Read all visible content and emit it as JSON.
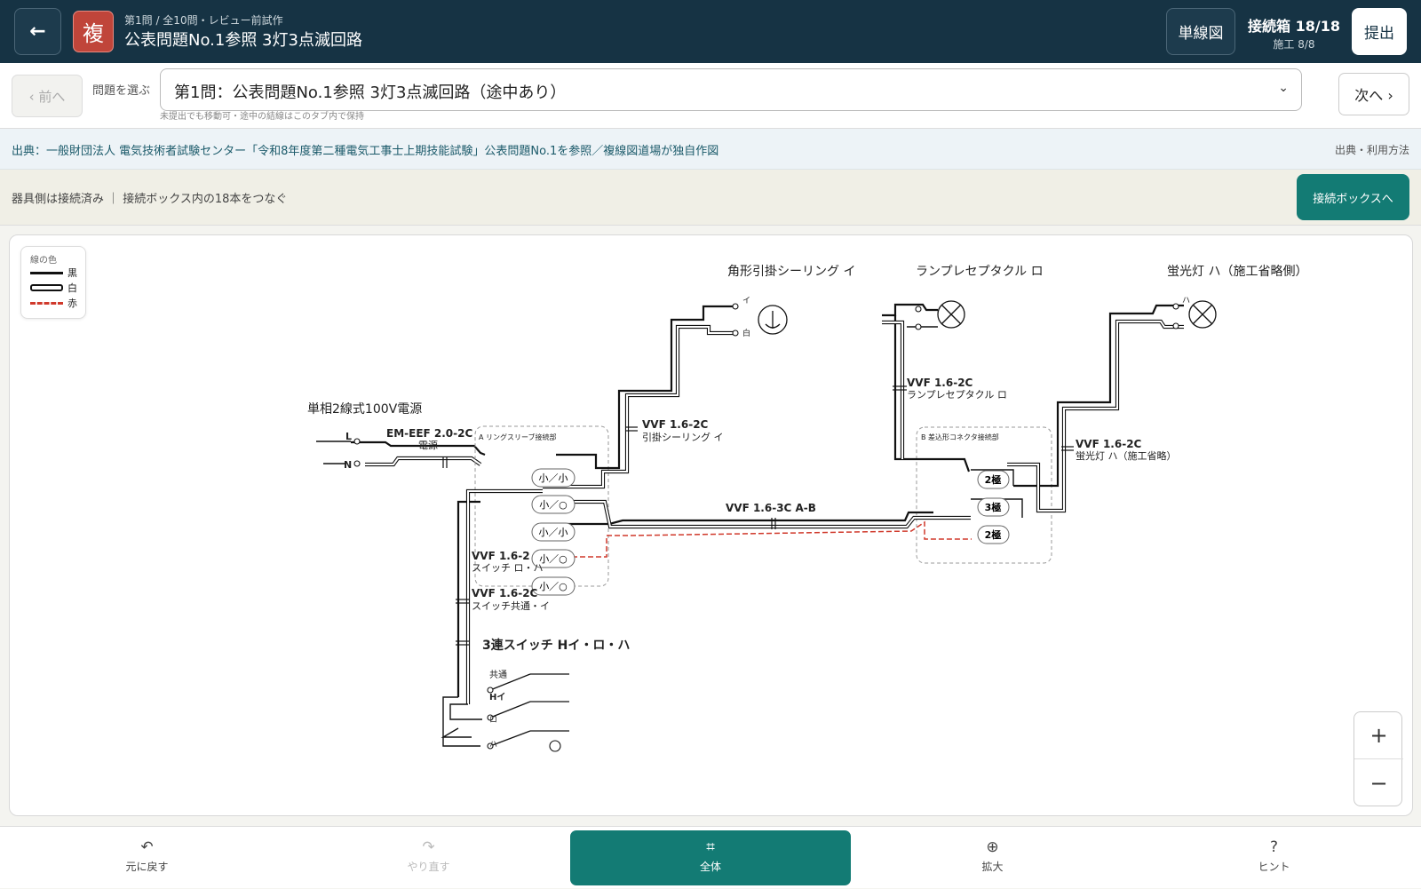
{
  "header": {
    "back_icon": "←",
    "badge": "複",
    "subtitle": "第1問 / 全10問・レビュー前試作",
    "title": "公表問題No.1参照 3灯3点滅回路",
    "single_line_button": "単線図",
    "status_line1": "接続箱 18/18",
    "status_line2": "施工 8/8",
    "submit_button": "提出"
  },
  "selector": {
    "prev_button": "‹ 前へ",
    "label": "問題を選ぶ",
    "selected": "第1問：公表問題No.1参照 3灯3点滅回路（途中あり）",
    "chevron": "⌄",
    "hint": "未提出でも移動可・途中の結線はこのタブ内で保持",
    "next_button": "次へ ›"
  },
  "source": {
    "text": "出典：一般財団法人 電気技術者試験センター「令和8年度第二種電気工事士上期技能試験」公表問題No.1を参照／複線図道場が独自作図",
    "link": "出典・利用方法"
  },
  "instruction": {
    "text": "器具側は接続済み ｜ 接続ボックス内の18本をつなぐ",
    "button": "接続ボックスへ"
  },
  "legend": {
    "title": "線の色",
    "items": [
      {
        "label": "黒",
        "color": "#111111"
      },
      {
        "label": "白",
        "color": "#ffffff"
      },
      {
        "label": "赤",
        "color": "#d0392b"
      }
    ]
  },
  "diagram": {
    "power_title": "単相2線式100V電源",
    "terminal_L": "L",
    "terminal_N": "N",
    "cable_source": "EM-EEF 2.0-2C",
    "cable_source_sub": "電源",
    "box_A_label": "A リングスリーブ接続部",
    "box_B_label": "B 差込形コネクタ接続部",
    "sleeves": [
      "小／小",
      "小／○",
      "小／小",
      "小／○",
      "小／○"
    ],
    "connectors": [
      "2極",
      "3極",
      "2極"
    ],
    "fixture_i_title": "角形引掛シーリング イ",
    "fixture_i_mark": "イ",
    "fixture_i_white": "白",
    "fixture_ro_title": "ランプレセプタクル ロ",
    "fixture_ha_title": "蛍光灯 ハ（施工省略側）",
    "fixture_ha_mark": "ハ",
    "cable_i": "VVF 1.6-2C",
    "cable_i_sub": "引掛シーリング イ",
    "cable_ro": "VVF 1.6-2C",
    "cable_ro_sub": "ランプレセプタクル ロ",
    "cable_ha": "VVF 1.6-2C",
    "cable_ha_sub": "蛍光灯 ハ（施工省略）",
    "cable_ab": "VVF 1.6-3C A-B",
    "cable_sw_roha": "VVF 1.6-2",
    "cable_sw_roha_sub": "スイッチ ロ・ハ",
    "cable_sw_common": "VVF 1.6-2C",
    "cable_sw_common_sub": "スイッチ共通・イ",
    "switch_title": "3連スイッチ Hイ・ロ・ハ",
    "switch_common": "共通",
    "switch_hi": "Hイ",
    "switch_ro": "ロ",
    "switch_ha": "ハ"
  },
  "zoom": {
    "in": "+",
    "out": "−"
  },
  "bottom": [
    {
      "icon": "↶",
      "label": "元に戻す"
    },
    {
      "icon": "↷",
      "label": "やり直す"
    },
    {
      "icon": "⌗",
      "label": "全体"
    },
    {
      "icon": "⊕",
      "label": "拡大"
    },
    {
      "icon": "?",
      "label": "ヒント"
    }
  ],
  "colors": {
    "header": "#163344",
    "accent": "#137b74",
    "badge": "#c0453a",
    "red_wire": "#d0392b"
  }
}
